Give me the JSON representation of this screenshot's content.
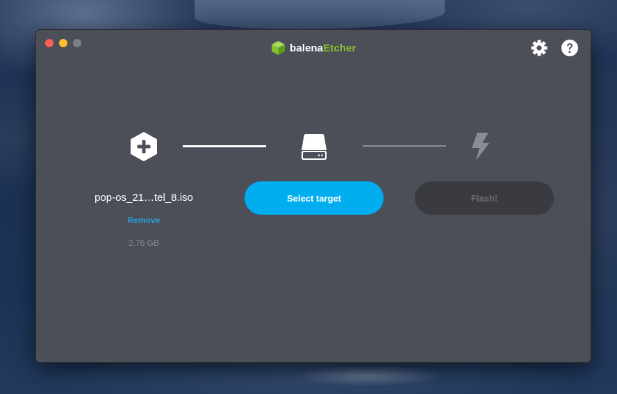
{
  "app": {
    "brand_prefix": "balena",
    "brand_suffix": "Etcher",
    "brand_colors": {
      "prefix": "#ffffff",
      "suffix": "#85c12e"
    }
  },
  "window_controls": [
    "close",
    "minimize",
    "zoom"
  ],
  "toolbar": {
    "settings_icon": "gear-icon",
    "help_icon": "question-circle-icon"
  },
  "steps": {
    "image": {
      "icon": "plus-hexagon-icon",
      "filename": "pop-os_21…tel_8.iso",
      "remove_label": "Remove",
      "size": "2.76 GB"
    },
    "target": {
      "icon": "drive-icon",
      "button_label": "Select target"
    },
    "flash": {
      "icon": "lightning-icon",
      "button_label": "Flash!"
    }
  },
  "colors": {
    "window_bg": "#4d4f58",
    "accent": "#00aeef",
    "link": "#2a9fd8",
    "disabled_button": "#3a3b41"
  }
}
